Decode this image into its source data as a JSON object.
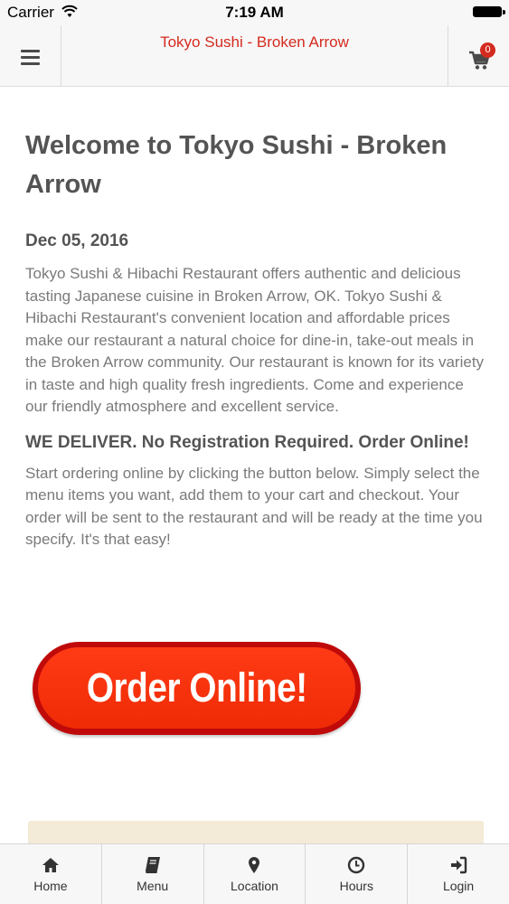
{
  "status_bar": {
    "carrier": "Carrier",
    "time": "7:19 AM"
  },
  "header": {
    "title": "Tokyo Sushi - Broken Arrow",
    "cart_count": "0"
  },
  "main": {
    "heading": "Welcome to Tokyo Sushi - Broken Arrow",
    "date": "Dec 05, 2016",
    "description": "Tokyo Sushi & Hibachi Restaurant offers authentic and delicious tasting Japanese cuisine in Broken Arrow, OK.  Tokyo Sushi & Hibachi Restaurant's convenient location and affordable prices make our restaurant a natural choice for dine-in, take-out meals in the Broken Arrow community. Our restaurant is known for its variety in taste and high quality fresh ingredients. Come and experience our friendly atmosphere and excellent service.",
    "delivery_heading": "WE DELIVER. No Registration Required. Order Online!",
    "instructions": "Start ordering online by clicking the button below. Simply select the menu items you want, add them to your cart and checkout. Your order will be sent to the restaurant and will be ready at the time you specify. It's that easy!",
    "order_button_label": "Order Online!"
  },
  "tab_bar": {
    "items": [
      {
        "label": "Home",
        "icon": "home-icon"
      },
      {
        "label": "Menu",
        "icon": "book-icon"
      },
      {
        "label": "Location",
        "icon": "map-marker-icon"
      },
      {
        "label": "Hours",
        "icon": "clock-icon"
      },
      {
        "label": "Login",
        "icon": "sign-in-icon"
      }
    ]
  },
  "colors": {
    "brand_red": "#d42a1f",
    "order_button": "#ee2b05",
    "promo_strip": "#f3ead7"
  }
}
